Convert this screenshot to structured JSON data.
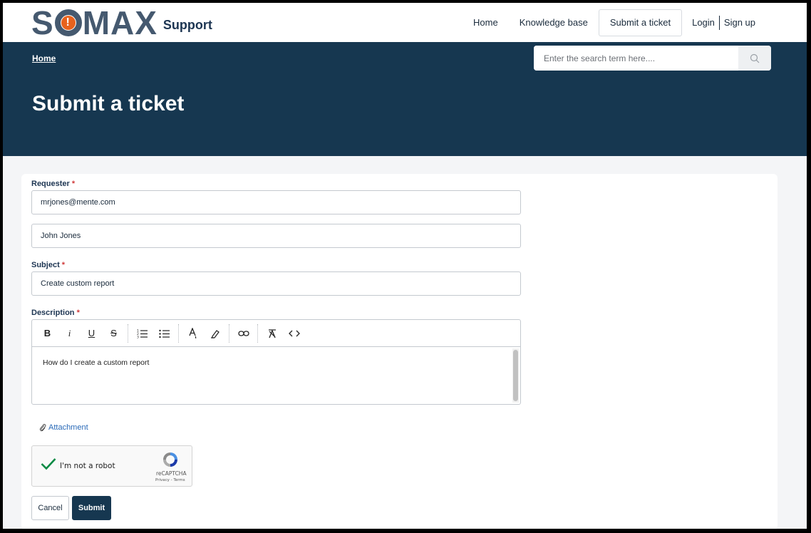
{
  "brand": {
    "logo_text_left": "S",
    "logo_o_glyph": "!",
    "logo_text_right": "MAX",
    "product": "Support",
    "colors": {
      "navy": "#163750",
      "logo_slate": "#45596f",
      "logo_orange": "#e8621d",
      "link": "#2a6ab8",
      "required": "#d03a3a"
    }
  },
  "nav": {
    "home": "Home",
    "knowledge_base": "Knowledge base",
    "submit_ticket": "Submit a ticket",
    "login": "Login",
    "signup": "Sign up"
  },
  "hero": {
    "breadcrumb": "Home",
    "search_placeholder": "Enter the search term here....",
    "title": "Submit a ticket"
  },
  "form": {
    "requester_label": "Requester",
    "required_mark": "*",
    "requester_email": "mrjones@mente.com",
    "requester_name": "John Jones",
    "subject_label": "Subject",
    "subject_value": "Create custom report",
    "description_label": "Description",
    "description_value": "How do I create a custom report",
    "toolbar": {
      "bold": "B",
      "italic": "i",
      "underline": "U",
      "strikethrough": "S"
    },
    "attachment": "Attachment",
    "captcha": {
      "label": "I'm not a robot",
      "brand": "reCAPTCHA",
      "terms": "Privacy - Terms"
    },
    "cancel": "Cancel",
    "submit": "Submit"
  }
}
